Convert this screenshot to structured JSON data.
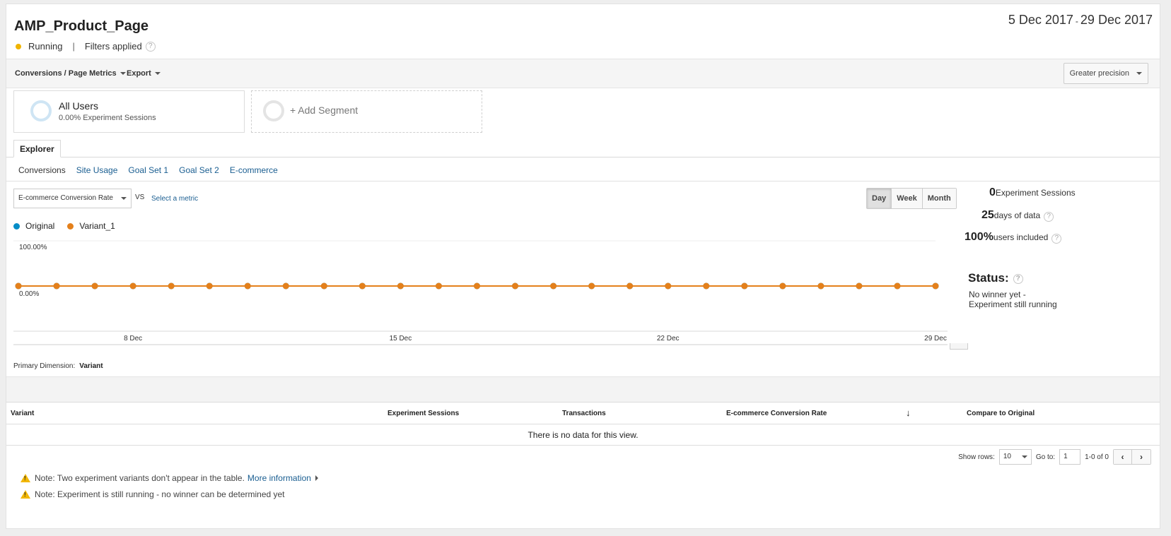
{
  "header": {
    "title": "AMP_Product_Page",
    "status": "Running",
    "separator": "|",
    "filters": "Filters applied",
    "date_start": "5 Dec 2017",
    "date_dash": "-",
    "date_end": "29 Dec 2017"
  },
  "toolbar": {
    "metrics_menu": "Conversions / Page Metrics",
    "export_menu": "Export",
    "precision": "Greater precision"
  },
  "segments": {
    "all_users": "All Users",
    "all_users_sub": "0.00% Experiment Sessions",
    "add": "+ Add Segment"
  },
  "explorer": {
    "tab": "Explorer",
    "subtabs": [
      "Conversions",
      "Site Usage",
      "Goal Set 1",
      "Goal Set 2",
      "E-commerce"
    ]
  },
  "chart_controls": {
    "metric": "E-commerce Conversion Rate",
    "vs": "VS",
    "select_metric": "Select a metric",
    "periods": [
      "Day",
      "Week",
      "Month"
    ],
    "selected_period": "Day"
  },
  "chart_data": {
    "type": "line",
    "series": [
      {
        "name": "Original",
        "color": "#058dc7",
        "values": [
          0,
          0,
          0,
          0,
          0,
          0,
          0,
          0,
          0,
          0,
          0,
          0,
          0,
          0,
          0,
          0,
          0,
          0,
          0,
          0,
          0,
          0,
          0,
          0,
          0
        ]
      },
      {
        "name": "Variant_1",
        "color": "#e4801b",
        "values": [
          0,
          0,
          0,
          0,
          0,
          0,
          0,
          0,
          0,
          0,
          0,
          0,
          0,
          0,
          0,
          0,
          0,
          0,
          0,
          0,
          0,
          0,
          0,
          0,
          0
        ]
      }
    ],
    "x": [
      "5 Dec",
      "6 Dec",
      "7 Dec",
      "8 Dec",
      "9 Dec",
      "10 Dec",
      "11 Dec",
      "12 Dec",
      "13 Dec",
      "14 Dec",
      "15 Dec",
      "16 Dec",
      "17 Dec",
      "18 Dec",
      "19 Dec",
      "20 Dec",
      "21 Dec",
      "22 Dec",
      "23 Dec",
      "24 Dec",
      "25 Dec",
      "26 Dec",
      "27 Dec",
      "28 Dec",
      "29 Dec"
    ],
    "x_tick_labels": [
      "8 Dec",
      "15 Dec",
      "22 Dec",
      "29 Dec"
    ],
    "y_tick_labels": [
      "100.00%",
      "0.00%"
    ],
    "ylim": [
      0,
      100
    ],
    "grid": true
  },
  "stats": {
    "sessions_value": "0",
    "sessions_label": "Experiment Sessions",
    "days_value": "25",
    "days_label": "days of data",
    "users_value": "100%",
    "users_label": "users included",
    "status_title": "Status:",
    "status_line1": "No winner yet -",
    "status_line2": "Experiment still running"
  },
  "dimension": {
    "label": "Primary Dimension:",
    "value": "Variant"
  },
  "table": {
    "columns": [
      "Variant",
      "Experiment Sessions",
      "Transactions",
      "E-commerce Conversion Rate",
      "Compare to Original"
    ],
    "empty": "There is no data for this view."
  },
  "pager": {
    "show_rows_label": "Show rows:",
    "rows": "10",
    "goto_label": "Go to:",
    "goto_value": "1",
    "range": "1-0 of 0"
  },
  "notes": {
    "note1": "Note: Two experiment variants don't appear in the table.",
    "note1_link": "More information",
    "note2": "Note: Experiment is still running - no winner can be determined yet"
  }
}
